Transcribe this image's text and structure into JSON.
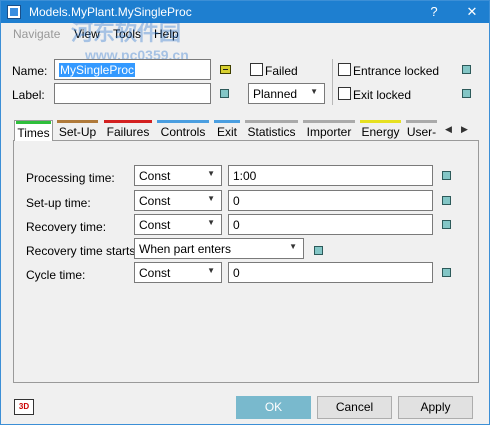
{
  "titlebar": {
    "title": "Models.MyPlant.MySingleProc",
    "help_btn": "?",
    "close_btn": "✕"
  },
  "menu": [
    "Navigate",
    "View",
    "Tools",
    "Help"
  ],
  "watermark": {
    "line1": "河东软件园",
    "line2": "www.pc0359.cn"
  },
  "header": {
    "name_label": "Name:",
    "name_value": "MySingleProc",
    "label_label": "Label:",
    "label_value": "",
    "failed": "Failed",
    "entrance_locked": "Entrance locked",
    "exit_locked": "Exit locked",
    "status_value": "Planned"
  },
  "tabs": [
    {
      "label": "Times",
      "color": "#2fbf3c",
      "active": true
    },
    {
      "label": "Set-Up",
      "color": "#b07a3a"
    },
    {
      "label": "Failures",
      "color": "#d32020"
    },
    {
      "label": "Controls",
      "color": "#4a9ee0"
    },
    {
      "label": "Exit",
      "color": "#4a9ee0"
    },
    {
      "label": "Statistics",
      "color": "#aaaaaa"
    },
    {
      "label": "Importer",
      "color": "#aaaaaa"
    },
    {
      "label": "Energy",
      "color": "#e6e020"
    },
    {
      "label": "User-",
      "color": "#aaaaaa"
    }
  ],
  "times": {
    "processing_label": "Processing time:",
    "processing_type": "Const",
    "processing_value": "1:00",
    "setup_label": "Set-up time:",
    "setup_type": "Const",
    "setup_value": "0",
    "recovery_label": "Recovery time:",
    "recovery_type": "Const",
    "recovery_value": "0",
    "recovery_starts_label": "Recovery time starts:",
    "recovery_starts_value": "When part enters",
    "cycle_label": "Cycle time:",
    "cycle_type": "Const",
    "cycle_value": "0"
  },
  "buttons": {
    "three_d": "3D",
    "ok": "OK",
    "cancel": "Cancel",
    "apply": "Apply"
  }
}
